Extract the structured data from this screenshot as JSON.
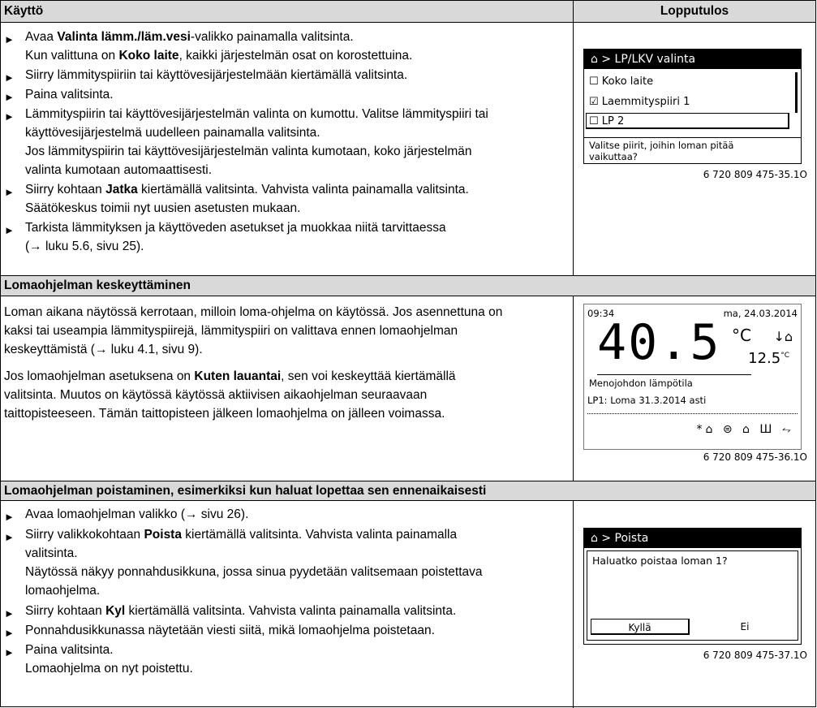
{
  "header": {
    "left": "Käyttö",
    "right": "Lopputulos"
  },
  "section1": {
    "items": [
      {
        "pre": "Avaa ",
        "bold": "Valinta lämm./läm.vesi",
        "post": "-valikko painamalla valitsinta."
      },
      {
        "pre": "Kun valittuna on ",
        "bold": "Koko laite",
        "post": ", kaikki järjestelmän osat on korostettuina."
      },
      {
        "text": "Siirry lämmityspiiriin tai käyttövesijärjestelmään kiertämällä valitsinta."
      },
      {
        "text": "Paina valitsinta."
      },
      {
        "text": "Lämmityspiirin tai käyttövesijärjestelmän valinta on kumottu. Valitse lämmityspiiri tai"
      },
      {
        "text": "käyttövesijärjestelmä uudelleen painamalla valitsinta."
      },
      {
        "text": "Jos lämmityspiirin tai käyttövesijärjestelmän valinta kumotaan, koko järjestelmän"
      },
      {
        "text": "valinta kumotaan automaattisesti."
      },
      {
        "pre": "Siirry kohtaan ",
        "bold": "Jatka",
        "post": " kiertämällä valitsinta. Vahvista valinta painamalla valitsinta."
      },
      {
        "text": "Säätökeskus toimii nyt uusien asetusten mukaan."
      },
      {
        "text": "Tarkista lämmityksen ja käyttöveden asetukset ja muokkaa niitä tarvittaessa"
      },
      {
        "text": "(→ luku 5.6, sivu 25)."
      }
    ],
    "screen": {
      "title": "⌂ > LP/LKV valinta",
      "options": [
        "Koko laite",
        "Laemmityspiiri 1",
        "LP 2"
      ],
      "checks": [
        "☐",
        "☑",
        "☐"
      ],
      "help": [
        "Valitse piirit, joihin loman pitää",
        "vaikuttaa?"
      ],
      "caption": "6 720 809 475-35.1O"
    }
  },
  "section2": {
    "title": "Lomaohjelman keskeyttäminen",
    "lines": [
      "Loman aikana näytössä kerrotaan, milloin loma-ohjelma on käytössä. Jos asennettuna on",
      "kaksi tai useampia lämmityspiirejä, lämmityspiiri on valittava ennen lomaohjelman",
      "keskeyttämistä (→ luku 4.1, sivu 9)."
    ],
    "para2": [
      {
        "pre": "Jos lomaohjelman asetuksena on ",
        "bold": "Kuten lauantai",
        "post": ", sen voi keskeyttää kiertämällä"
      },
      {
        "text": "valitsinta. Muutos on käytössä käytössä aktiivisen aikaohjelman seuraavaan"
      },
      {
        "text": "taittopisteeseen. Tämän taittopisteen jälkeen lomaohjelma on jälleen voimassa."
      }
    ],
    "screen": {
      "time": "09:34",
      "date": "ma, 24.03.2014",
      "temp": "40.5",
      "unit": "°C",
      "outdoor": "12.5",
      "outdoor_unit": "°C",
      "label": "Menojohdon lämpötila",
      "status": "LP1: Loma 31.3.2014 asti",
      "icons": "*⌂ ⊜ ⌂ Ш ⥊",
      "caption": "6 720 809 475-36.1O"
    }
  },
  "section3": {
    "title": "Lomaohjelman poistaminen, esimerkiksi kun haluat lopettaa sen ennenaikaisesti",
    "items": [
      {
        "text": "Avaa lomaohjelman valikko (→ sivu 26)."
      },
      {
        "pre": "Siirry valikkokohtaan ",
        "bold": "Poista",
        "post": " kiertämällä valitsinta. Vahvista valinta painamalla"
      },
      {
        "text": "valitsinta."
      },
      {
        "text": "Näytössä näkyy ponnahdusikkuna, jossa sinua pyydetään valitsemaan poistettava"
      },
      {
        "text": "lomaohjelma."
      },
      {
        "pre": "Siirry kohtaan ",
        "bold": "Kyl",
        "post": " kiertämällä valitsinta. Vahvista valinta painamalla valitsinta."
      },
      {
        "text": "Ponnahdusikkunassa näytetään viesti siitä, mikä lomaohjelma poistetaan."
      },
      {
        "text": "Paina valitsinta."
      },
      {
        "text": "Lomaohjelma on nyt poistettu."
      }
    ],
    "screen": {
      "title": "⌂ > Poista",
      "question": "Haluatko poistaa loman 1?",
      "yes": "Kyllä",
      "no": "Ei",
      "caption": "6 720 809 475-37.1O"
    }
  }
}
